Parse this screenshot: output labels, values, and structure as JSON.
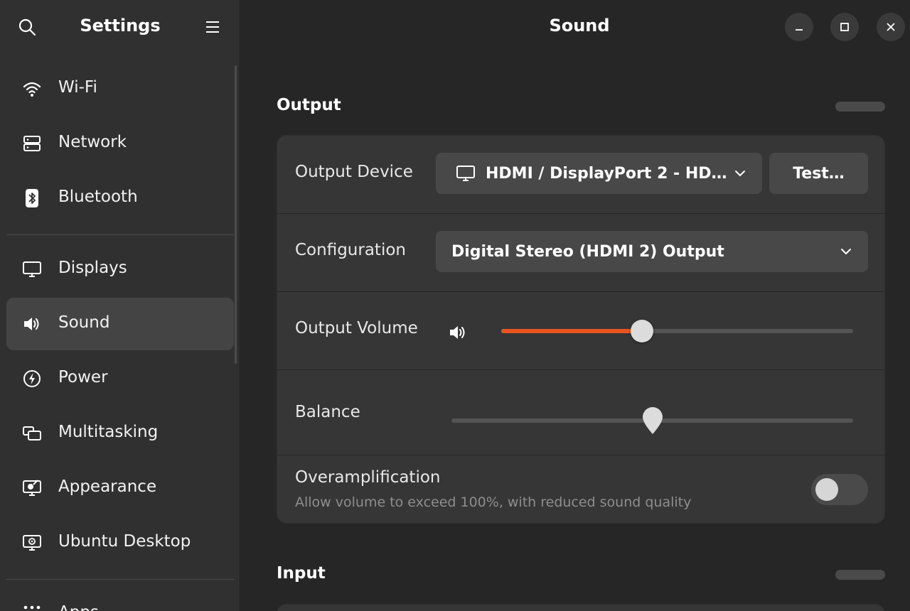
{
  "sidebar": {
    "title": "Settings",
    "items": [
      {
        "label": "Wi-Fi",
        "icon": "wifi-icon"
      },
      {
        "label": "Network",
        "icon": "network-icon"
      },
      {
        "label": "Bluetooth",
        "icon": "bluetooth-icon"
      },
      {
        "label": "Displays",
        "icon": "display-icon"
      },
      {
        "label": "Sound",
        "icon": "speaker-icon"
      },
      {
        "label": "Power",
        "icon": "power-icon"
      },
      {
        "label": "Multitasking",
        "icon": "multitasking-icon"
      },
      {
        "label": "Appearance",
        "icon": "appearance-icon"
      },
      {
        "label": "Ubuntu Desktop",
        "icon": "ubuntu-desktop-icon"
      },
      {
        "label": "Apps",
        "icon": "apps-icon"
      }
    ],
    "active": "Sound"
  },
  "main": {
    "title": "Sound"
  },
  "output": {
    "title": "Output",
    "device_label": "Output Device",
    "device_value": "HDMI / DisplayPort 2 - HD…",
    "test_label": "Test…",
    "configuration_label": "Configuration",
    "configuration_value": "Digital Stereo (HDMI 2) Output",
    "volume_label": "Output Volume",
    "volume_level": 0.4,
    "balance_label": "Balance",
    "balance_level": 0.5,
    "overamp_label": "Overamplification",
    "overamp_desc": "Allow volume to exceed 100%, with reduced sound quality",
    "overamp_enabled": false
  },
  "input": {
    "title": "Input"
  },
  "colors": {
    "accent": "#e95420",
    "card": "#363636",
    "sidebar": "#303030",
    "main": "#262626"
  }
}
